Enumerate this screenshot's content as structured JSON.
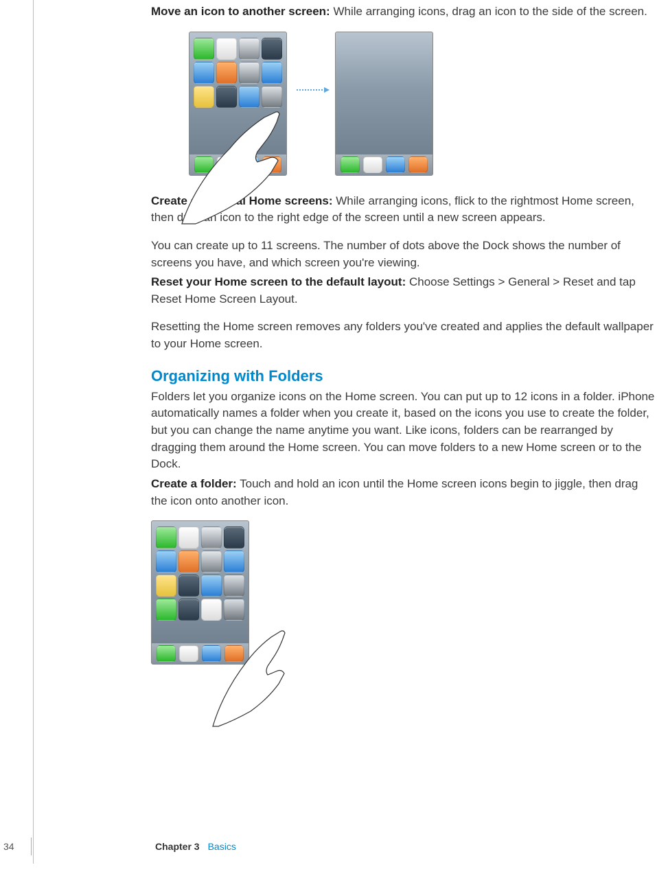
{
  "paragraphs": {
    "p1_bold": "Move an icon to another screen:",
    "p1_text": "  While arranging icons, drag an icon to the side of the screen.",
    "p2_bold": "Create additional Home screens:",
    "p2_text": "  While arranging icons, flick to the rightmost Home screen, then drag an icon to the right edge of the screen until a new screen appears.",
    "p3_text": "You can create up to 11 screens. The number of dots above the Dock shows the number of screens you have, and which screen you're viewing.",
    "p4_bold": "Reset your Home screen to the default layout:",
    "p4_text": "  Choose Settings > General > Reset and tap Reset Home Screen Layout.",
    "p5_text": "Resetting the Home screen removes any folders you've created and applies the default wallpaper to your Home screen.",
    "heading": "Organizing with Folders",
    "p6_text": "Folders let you organize icons on the Home screen. You can put up to 12 icons in a folder. iPhone automatically names a folder when you create it, based on the icons you use to create the folder, but you can change the name anytime you want. Like icons, folders can be rearranged by dragging them around the Home screen. You can move folders to a new Home screen or to the Dock.",
    "p7_bold": "Create a folder:",
    "p7_text": "  Touch and hold an icon until the Home screen icons begin to jiggle, then drag the icon onto another icon."
  },
  "footer": {
    "page_number": "34",
    "chapter_label": "Chapter 3",
    "chapter_name": "Basics"
  }
}
